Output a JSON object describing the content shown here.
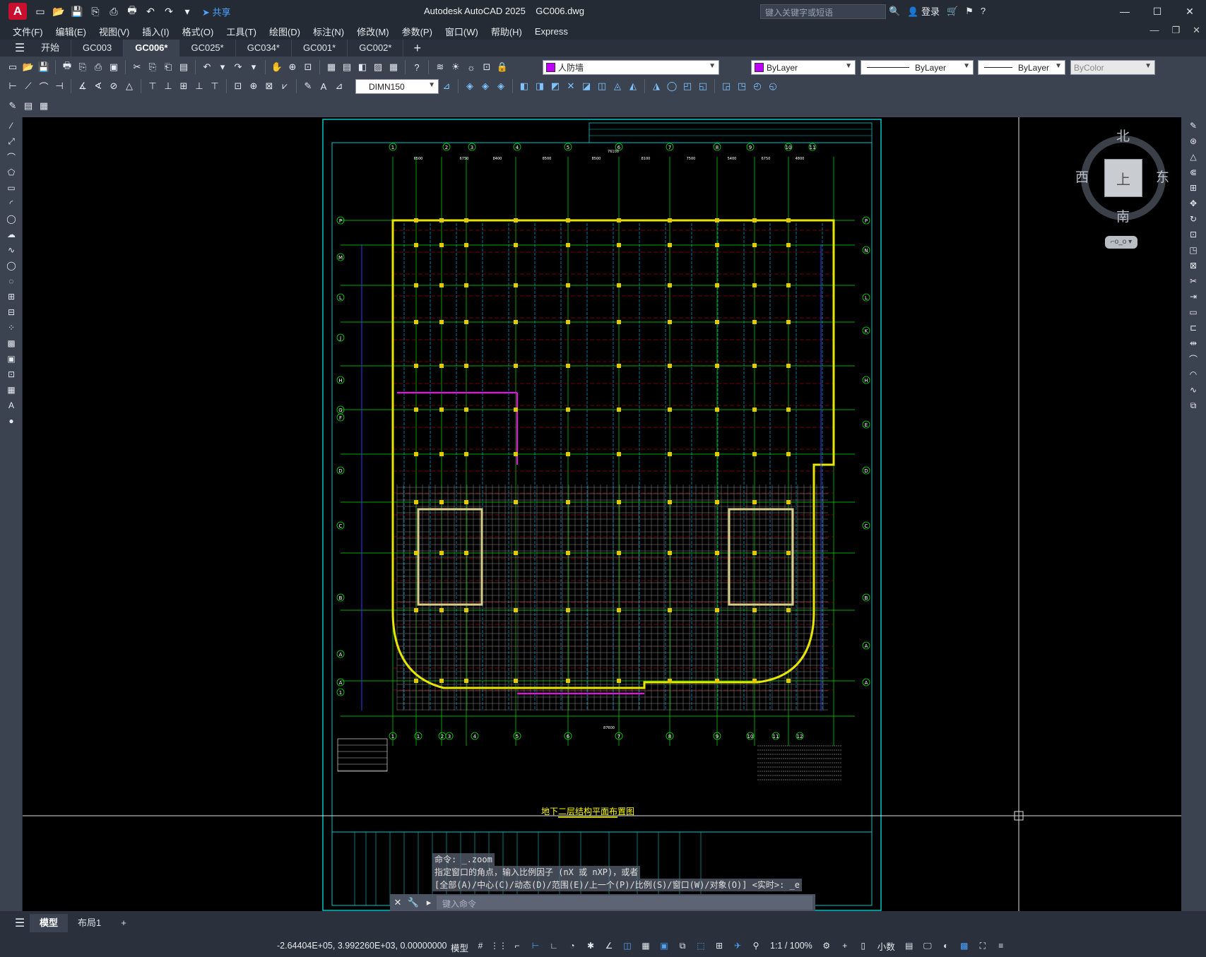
{
  "window": {
    "app_title": "Autodesk AutoCAD 2025",
    "file_name": "GC006.dwg",
    "search_placeholder": "键入关键字或短语",
    "login": "登录",
    "share": "共享"
  },
  "menu": [
    "文件(F)",
    "编辑(E)",
    "视图(V)",
    "插入(I)",
    "格式(O)",
    "工具(T)",
    "绘图(D)",
    "标注(N)",
    "修改(M)",
    "参数(P)",
    "窗口(W)",
    "帮助(H)",
    "Express"
  ],
  "tabs": [
    {
      "label": "开始",
      "active": false
    },
    {
      "label": "GC003",
      "active": false
    },
    {
      "label": "GC006*",
      "active": true
    },
    {
      "label": "GC025*",
      "active": false
    },
    {
      "label": "GC034*",
      "active": false
    },
    {
      "label": "GC001*",
      "active": false
    },
    {
      "label": "GC002*",
      "active": false
    }
  ],
  "properties": {
    "layer": "人防墙",
    "layer_color": "#c000ff",
    "color": "ByLayer",
    "color_swatch": "#c000ff",
    "linetype": "ByLayer",
    "lineweight": "ByLayer",
    "plotstyle": "ByColor",
    "dimstyle": "DIMN150"
  },
  "viewcube": {
    "north": "北",
    "south": "南",
    "east": "东",
    "west": "西",
    "face": "上",
    "wcs": "WCS"
  },
  "drawing": {
    "title": "地下二层结构平面布置图",
    "grid_top": [
      "1",
      "2",
      "3",
      "4",
      "5",
      "6",
      "7",
      "8",
      "9",
      "10",
      "11"
    ],
    "grid_bottom": [
      "1",
      "1",
      "2",
      "3",
      "4",
      "5",
      "6",
      "7",
      "8",
      "9",
      "10",
      "11",
      "12"
    ],
    "grid_left": [
      "P",
      "M",
      "L",
      "J",
      "H",
      "G",
      "F",
      "D",
      "C",
      "B",
      "A",
      "A",
      "1"
    ],
    "grid_right": [
      "P",
      "N",
      "L",
      "K",
      "H",
      "E",
      "D",
      "C",
      "B",
      "A",
      "A"
    ],
    "dims_top": [
      "6500",
      "6750",
      "8400",
      "8500",
      "8500",
      "8100",
      "7500",
      "5400",
      "6750",
      "4800"
    ],
    "total_top": "76100",
    "total_bottom": "87600"
  },
  "command": {
    "history": [
      "命令: _.zoom",
      "指定窗口的角点，输入比例因子 (nX 或 nXP)，或者",
      "[全部(A)/中心(C)/动态(D)/范围(E)/上一个(P)/比例(S)/窗口(W)/对象(O)] <实时>: _e"
    ],
    "placeholder": "键入命令"
  },
  "layouts": [
    {
      "label": "模型",
      "active": true
    },
    {
      "label": "布局1",
      "active": false
    }
  ],
  "status": {
    "coords": "-2.64404E+05, 3.992260E+03, 0.00000000",
    "space": "模型",
    "scale": "1:1 / 100%",
    "units": "小数"
  }
}
